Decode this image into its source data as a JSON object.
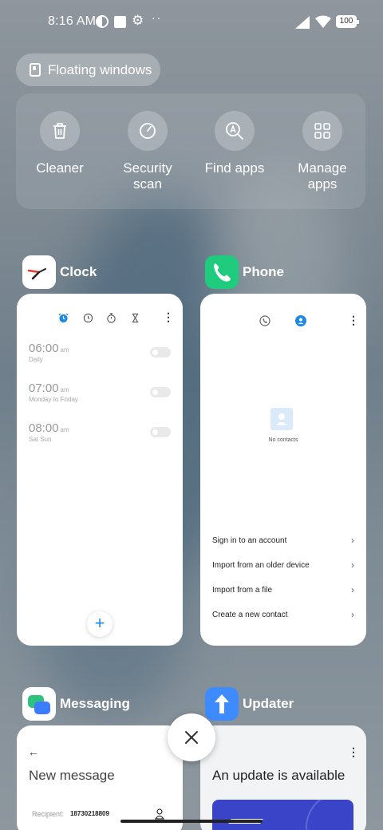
{
  "status_bar": {
    "time": "8:16 AM",
    "battery": "100",
    "icons": [
      "data-saver-icon",
      "square-notification-icon",
      "settings-gear-icon",
      "more-dots-icon",
      "cell-signal-icon",
      "wifi-icon",
      "battery-icon"
    ]
  },
  "floating_windows": {
    "label": "Floating windows",
    "icon": "floating-window-icon"
  },
  "quick_actions": [
    {
      "label": "Cleaner",
      "icon": "trash-icon"
    },
    {
      "label": "Security scan",
      "icon": "security-scan-icon"
    },
    {
      "label": "Find apps",
      "icon": "find-apps-icon"
    },
    {
      "label": "Manage apps",
      "icon": "grid-apps-icon"
    }
  ],
  "apps": {
    "clock": {
      "name": "Clock",
      "alarms": [
        {
          "time": "06:00",
          "ampm": "am",
          "repeat": "Daily"
        },
        {
          "time": "07:00",
          "ampm": "am",
          "repeat": "Monday to Friday"
        },
        {
          "time": "08:00",
          "ampm": "am",
          "repeat": "Sat Sun"
        }
      ],
      "fab": "+"
    },
    "phone": {
      "name": "Phone",
      "empty_text": "No contacts",
      "options": [
        "Sign in to an account",
        "Import from an older device",
        "Import from a file",
        "Create a new contact"
      ]
    },
    "messaging": {
      "name": "Messaging",
      "title": "New message",
      "recipient_label": "Recipient:",
      "recipient_value": "18730218809"
    },
    "updater": {
      "name": "Updater",
      "title": "An update is available"
    }
  },
  "colors": {
    "accent": "#1e88e5",
    "phone_green": "#1fcc7e",
    "updater_blue": "#3d8bff",
    "update_banner": "#3944c9"
  }
}
